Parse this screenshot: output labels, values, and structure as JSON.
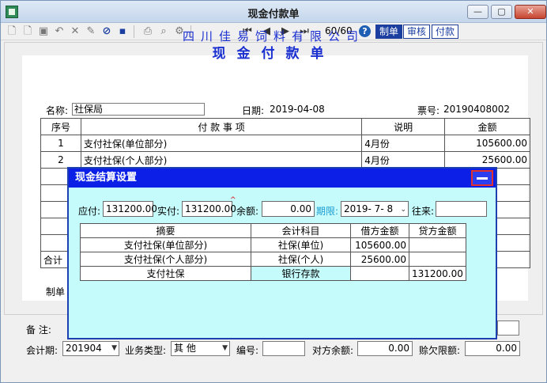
{
  "window": {
    "title": "现金付款单"
  },
  "toolbar": {
    "pager": "60/60",
    "tabs": [
      "制单",
      "审核",
      "付款"
    ],
    "icons": [
      "new-icon",
      "copy-icon",
      "edit-icon",
      "undo-icon",
      "delete-icon",
      "approve-icon",
      "cancel-icon",
      "save-icon",
      "print-icon",
      "find-icon",
      "settings-icon",
      "first-icon",
      "prev-icon",
      "next-icon",
      "last-icon",
      "help-icon"
    ]
  },
  "doc": {
    "company": "四川佳易饲料有限公司",
    "title": "现金付款单",
    "name_label": "名称:",
    "name_value": "社保局",
    "date_label": "日期:",
    "date_value": "2019-04-08",
    "ticket_label": "票号:",
    "ticket_value": "20190408002",
    "headers": {
      "seq": "序号",
      "item": "付 款 事 项",
      "note": "说明",
      "amount": "金额"
    },
    "rows": [
      {
        "seq": "1",
        "item": "支付社保(单位部分)",
        "note": "4月份",
        "amount": "105600.00"
      },
      {
        "seq": "2",
        "item": "支付社保(个人部分)",
        "note": "4月份",
        "amount": "25600.00"
      }
    ],
    "total_label": "合计",
    "maker_label": "制单"
  },
  "bottom": {
    "remark_label": "备  注:",
    "period_label": "会计期:",
    "period_value": "201904",
    "biz_type_label": "业务类型:",
    "biz_type_value": "其  他",
    "number_label": "编号:",
    "number_value": "",
    "counter_balance_label": "对方余额:",
    "counter_balance_value": "0.00",
    "credit_limit_label": "赊欠限额:",
    "credit_limit_value": "0.00"
  },
  "modal": {
    "title": "现金结算设置",
    "payable_label": "应付:",
    "payable_value": "131200.00",
    "paid_label": "实付:",
    "paid_value": "131200.00",
    "balance_label": "余额:",
    "balance_value": "0.00",
    "term_label": "期限:",
    "term_value": "2019- 7- 8",
    "contact_label": "往来:",
    "contact_value": "",
    "headers": {
      "summary": "摘要",
      "account": "会计科目",
      "debit": "借方金额",
      "credit": "贷方金额"
    },
    "rows": [
      {
        "summary": "支付社保(单位部分)",
        "account": "社保(单位)",
        "debit": "105600.00",
        "credit": ""
      },
      {
        "summary": "支付社保(个人部分)",
        "account": "社保(个人)",
        "debit": "25600.00",
        "credit": ""
      },
      {
        "summary": "支付社保",
        "account": "银行存款",
        "debit": "",
        "credit": "131200.00"
      }
    ]
  },
  "colors": {
    "accent": "#0b1fe6",
    "modal_bg": "#c5fbfb",
    "doc_blue": "#1a2fd0"
  }
}
